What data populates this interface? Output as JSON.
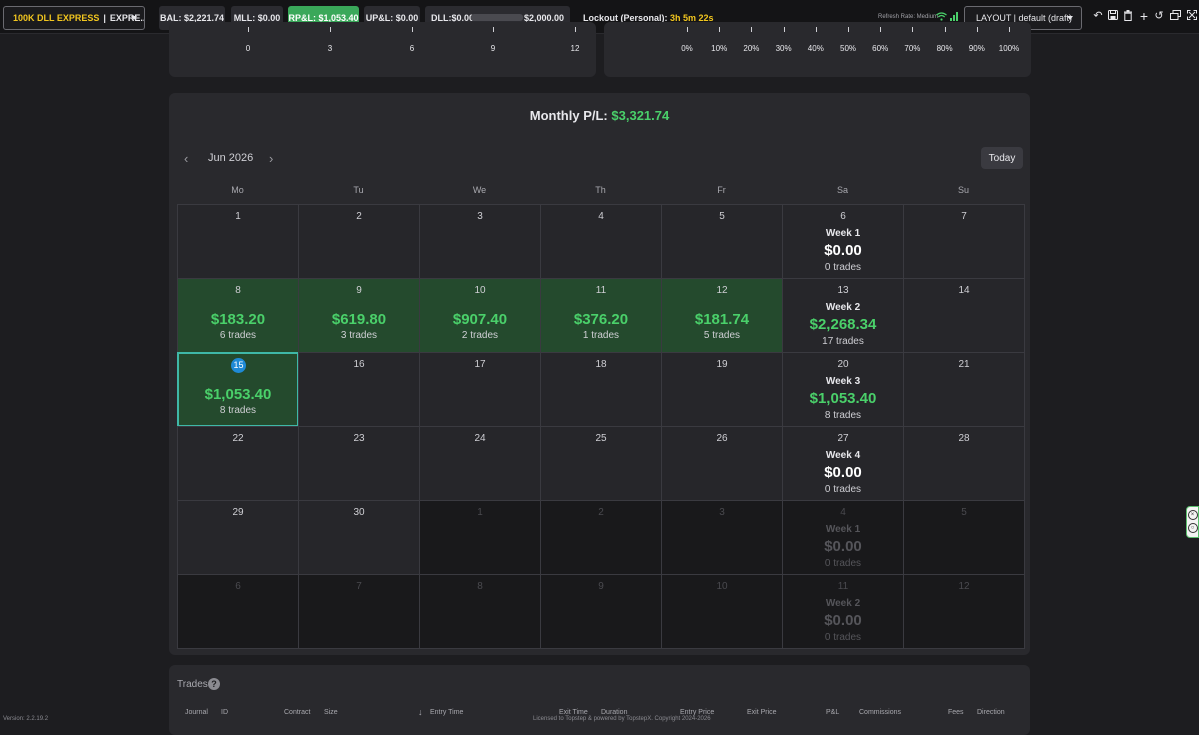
{
  "topbar": {
    "account_name": "100K DLL EXPRESS",
    "account_sep": "|",
    "account_type": "EXPRE...",
    "bal": "BAL: $2,221.74",
    "mll": "MLL: $0.00",
    "rpl": "RP&L: $1,053.40",
    "upl": "UP&L: $0.00",
    "dll": "DLL:$0.00",
    "dll_limit": "$2,000.00",
    "lockout_label": "Lockout (Personal):",
    "lockout_time": "3h 5m 22s",
    "refresh_rate": "Refresh Rate: Medium",
    "layout": "LAYOUT | default (draft)",
    "colors": {
      "accent_yellow": "#f2c61f",
      "rpl_green": "#3aa85a"
    }
  },
  "upper_left_axis": [
    "0",
    "3",
    "6",
    "9",
    "12"
  ],
  "upper_right_axis": [
    "0%",
    "10%",
    "20%",
    "30%",
    "40%",
    "50%",
    "60%",
    "70%",
    "80%",
    "90%",
    "100%"
  ],
  "calendar": {
    "monthly_label": "Monthly P/L:",
    "monthly_value": "$3,321.74",
    "month": "Jun 2026",
    "today_button": "Today",
    "weekdays": [
      "Mo",
      "Tu",
      "We",
      "Th",
      "Fr",
      "Sa",
      "Su"
    ],
    "rows": [
      {
        "days": [
          {
            "n": "1"
          },
          {
            "n": "2"
          },
          {
            "n": "3"
          },
          {
            "n": "4"
          },
          {
            "n": "5"
          },
          {
            "n": "6",
            "week": {
              "title": "Week 1",
              "pnl": "$0.00",
              "trades": "0 trades",
              "positive": false
            }
          },
          {
            "n": "7"
          }
        ]
      },
      {
        "days": [
          {
            "n": "8",
            "pnl": "$183.20",
            "trades": "6 trades"
          },
          {
            "n": "9",
            "pnl": "$619.80",
            "trades": "3 trades"
          },
          {
            "n": "10",
            "pnl": "$907.40",
            "trades": "2 trades"
          },
          {
            "n": "11",
            "pnl": "$376.20",
            "trades": "1 trades"
          },
          {
            "n": "12",
            "pnl": "$181.74",
            "trades": "5 trades"
          },
          {
            "n": "13",
            "week": {
              "title": "Week 2",
              "pnl": "$2,268.34",
              "trades": "17 trades",
              "positive": true
            }
          },
          {
            "n": "14"
          }
        ]
      },
      {
        "days": [
          {
            "n": "15",
            "pnl": "$1,053.40",
            "trades": "8 trades",
            "today": true
          },
          {
            "n": "16"
          },
          {
            "n": "17"
          },
          {
            "n": "18"
          },
          {
            "n": "19"
          },
          {
            "n": "20",
            "week": {
              "title": "Week 3",
              "pnl": "$1,053.40",
              "trades": "8 trades",
              "positive": true
            }
          },
          {
            "n": "21"
          }
        ]
      },
      {
        "days": [
          {
            "n": "22"
          },
          {
            "n": "23"
          },
          {
            "n": "24"
          },
          {
            "n": "25"
          },
          {
            "n": "26"
          },
          {
            "n": "27",
            "week": {
              "title": "Week 4",
              "pnl": "$0.00",
              "trades": "0 trades",
              "positive": false
            }
          },
          {
            "n": "28"
          }
        ]
      },
      {
        "days": [
          {
            "n": "29"
          },
          {
            "n": "30"
          },
          {
            "n": "1",
            "other": true
          },
          {
            "n": "2",
            "other": true
          },
          {
            "n": "3",
            "other": true
          },
          {
            "n": "4",
            "other": true,
            "week": {
              "title": "Week 1",
              "pnl": "$0.00",
              "trades": "0 trades",
              "positive": false
            }
          },
          {
            "n": "5",
            "other": true
          }
        ]
      },
      {
        "days": [
          {
            "n": "6",
            "other": true
          },
          {
            "n": "7",
            "other": true
          },
          {
            "n": "8",
            "other": true
          },
          {
            "n": "9",
            "other": true
          },
          {
            "n": "10",
            "other": true
          },
          {
            "n": "11",
            "other": true,
            "week": {
              "title": "Week 2",
              "pnl": "$0.00",
              "trades": "0 trades",
              "positive": false
            }
          },
          {
            "n": "12",
            "other": true
          }
        ]
      }
    ]
  },
  "trades": {
    "title": "Trades",
    "columns": [
      "Journal",
      "ID",
      "Contract",
      "Size",
      "Entry Time",
      "Exit Time",
      "Duration",
      "Entry Price",
      "Exit Price",
      "P&L",
      "Commissions",
      "Fees",
      "Direction"
    ]
  },
  "footer": {
    "version": "Version: 2.2.19.2",
    "license": "Licensed to Topstep & powered by TopstepX. Copyright 2024-2026"
  }
}
